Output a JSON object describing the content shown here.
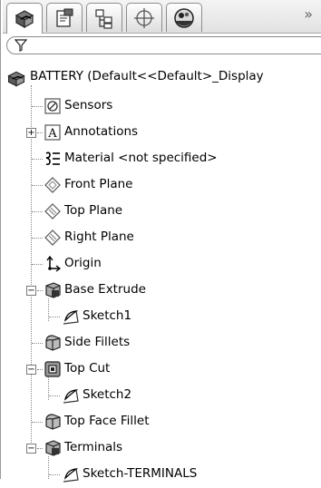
{
  "tabs": [
    "feature-manager-icon",
    "property-manager-icon",
    "configuration-manager-icon",
    "dimxpert-icon",
    "display-manager-icon"
  ],
  "more_label": "»",
  "filter": {
    "icon": "filter-icon",
    "value": ""
  },
  "tree": {
    "root": "BATTERY  (Default<<Default>_Display",
    "items": [
      {
        "label": "Sensors",
        "icon": "sensors-icon"
      },
      {
        "label": "Annotations",
        "icon": "annotations-icon",
        "expander": "+"
      },
      {
        "label": "Material <not specified>",
        "icon": "material-icon"
      },
      {
        "label": "Front Plane",
        "icon": "plane-icon"
      },
      {
        "label": "Top Plane",
        "icon": "plane-icon"
      },
      {
        "label": "Right Plane",
        "icon": "plane-icon"
      },
      {
        "label": "Origin",
        "icon": "origin-icon"
      },
      {
        "label": "Base Extrude",
        "icon": "extrude-icon",
        "expander": "−"
      },
      {
        "label": "Sketch1",
        "icon": "sketch-icon"
      },
      {
        "label": "Side Fillets",
        "icon": "fillet-icon"
      },
      {
        "label": "Top Cut",
        "icon": "cut-icon",
        "expander": "−"
      },
      {
        "label": "Sketch2",
        "icon": "sketch-icon"
      },
      {
        "label": "Top Face Fillet",
        "icon": "fillet-icon"
      },
      {
        "label": "Terminals",
        "icon": "extrude-icon",
        "expander": "−"
      },
      {
        "label": "Sketch-TERMINALS",
        "icon": "sketch-icon"
      }
    ]
  }
}
